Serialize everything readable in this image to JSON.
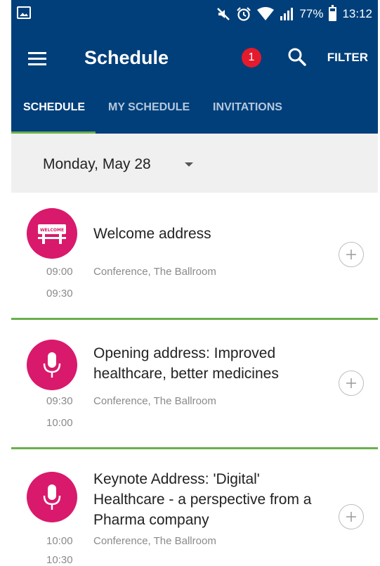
{
  "status_bar": {
    "battery_percent": "77%",
    "time": "13:12",
    "icons": [
      "image-notification-icon",
      "mute-icon",
      "alarm-icon",
      "wifi-icon",
      "signal-icon",
      "battery-icon"
    ]
  },
  "app_bar": {
    "title": "Schedule",
    "notification_count": "1",
    "filter_label": "FILTER"
  },
  "tabs": [
    {
      "label": "SCHEDULE",
      "active": true
    },
    {
      "label": "MY SCHEDULE",
      "active": false
    },
    {
      "label": "INVITATIONS",
      "active": false
    }
  ],
  "date_selector": {
    "label": "Monday, May 28"
  },
  "sessions": [
    {
      "title": "Welcome address",
      "start": "09:00",
      "end": "09:30",
      "location": "Conference, The Ballroom",
      "icon": "welcome-sign-icon",
      "icon_text": "WELCOME"
    },
    {
      "title_line1": "Opening address: Improved",
      "title_line2": "healthcare, better medicines",
      "start": "09:30",
      "end": "10:00",
      "location": "Conference, The Ballroom",
      "icon": "microphone-icon"
    },
    {
      "title_line1": "Keynote Address: 'Digital'",
      "title_line2": "Healthcare - a perspective from a",
      "title_line3": "Pharma company",
      "start": "10:00",
      "end": "10:30",
      "location": "Conference, The Ballroom",
      "icon": "microphone-icon"
    }
  ],
  "colors": {
    "primary": "#003f7a",
    "accent_green": "#6ab04c",
    "session_icon_bg": "#d9196c",
    "badge_red": "#e31b2d"
  }
}
